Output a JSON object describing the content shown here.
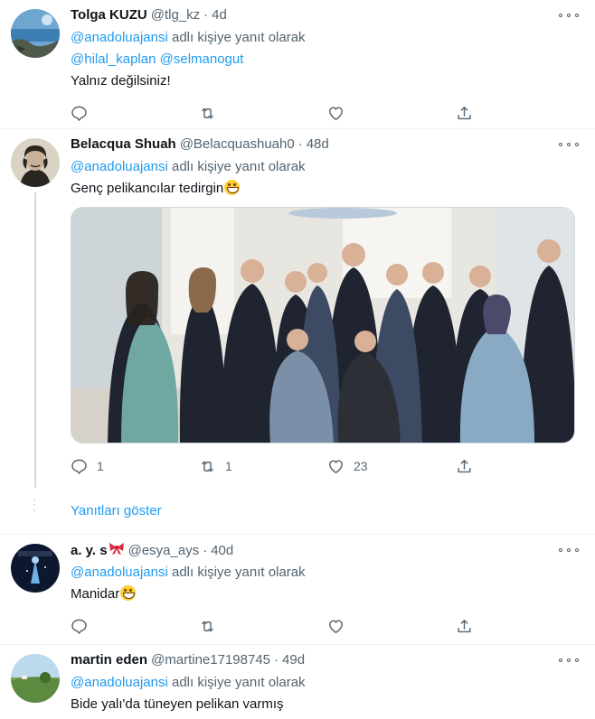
{
  "tweets": [
    {
      "name": "Tolga KUZU",
      "handle": "@tlg_kz",
      "dot": "·",
      "time": "4d",
      "reply_prefix": "@anadoluajansi",
      "reply_suffix": "adlı kişiye yanıt olarak",
      "mentions": "@hilal_kaplan @selmanogut",
      "text": "Yalnız değilsiniz!",
      "counts": {
        "reply": "",
        "retweet": "",
        "like": ""
      }
    },
    {
      "name": "Belacqua Shuah",
      "handle": "@Belacquashuah0",
      "dot": "·",
      "time": "48d",
      "reply_prefix": "@anadoluajansi",
      "reply_suffix": "adlı kişiye yanıt olarak",
      "text": "Genç pelikancılar tedirgin",
      "counts": {
        "reply": "1",
        "retweet": "1",
        "like": "23"
      }
    },
    {
      "name": "a. y. s",
      "handle": "@esya_ays",
      "dot": "·",
      "time": "40d",
      "reply_prefix": "@anadoluajansi",
      "reply_suffix": "adlı kişiye yanıt olarak",
      "text": "Manidar",
      "counts": {
        "reply": "",
        "retweet": "",
        "like": ""
      }
    },
    {
      "name": "martin eden",
      "handle": "@martine17198745",
      "dot": "·",
      "time": "49d",
      "reply_prefix": "@anadoluajansi",
      "reply_suffix": "adlı kişiye yanıt olarak",
      "text": "Bide yalı'da tüneyen pelikan varmış"
    }
  ],
  "show_replies": "Yanıtları göster",
  "icons": {
    "reply": "reply-icon",
    "retweet": "retweet-icon",
    "like": "heart-icon",
    "share": "share-icon",
    "more": "more-icon"
  },
  "colors": {
    "link": "#1d9bf0",
    "muted": "#536471",
    "text": "#0f1419"
  }
}
